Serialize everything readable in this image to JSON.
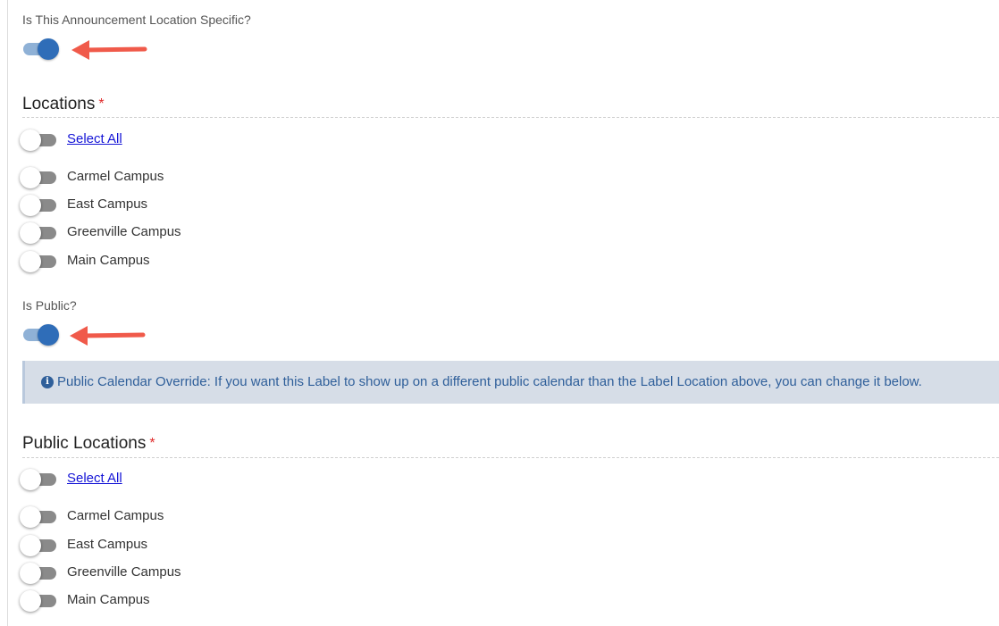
{
  "location_specific": {
    "question": "Is This Announcement Location Specific?",
    "enabled": true
  },
  "locations": {
    "title": "Locations",
    "required_mark": "*",
    "select_all_label": "Select All",
    "items": [
      {
        "label": "Carmel Campus",
        "checked": false
      },
      {
        "label": "East Campus",
        "checked": false
      },
      {
        "label": "Greenville Campus",
        "checked": false
      },
      {
        "label": "Main Campus",
        "checked": false
      }
    ]
  },
  "is_public": {
    "question": "Is Public?",
    "enabled": true
  },
  "info": {
    "icon": "info-circle-icon",
    "text": "Public Calendar Override: If you want this Label to show up on a different public calendar than the Label Location above, you can change it below."
  },
  "public_locations": {
    "title": "Public Locations",
    "required_mark": "*",
    "select_all_label": "Select All",
    "items": [
      {
        "label": "Carmel Campus",
        "checked": false
      },
      {
        "label": "East Campus",
        "checked": false
      },
      {
        "label": "Greenville Campus",
        "checked": false
      },
      {
        "label": "Main Campus",
        "checked": false
      }
    ]
  },
  "colors": {
    "toggle_on": "#2f6db8",
    "toggle_off_track": "#8a8a8a",
    "required": "#e02b2b",
    "annotation_arrow": "#f05a4a",
    "info_background": "#d6dde7",
    "info_text": "#2f5f9a"
  }
}
